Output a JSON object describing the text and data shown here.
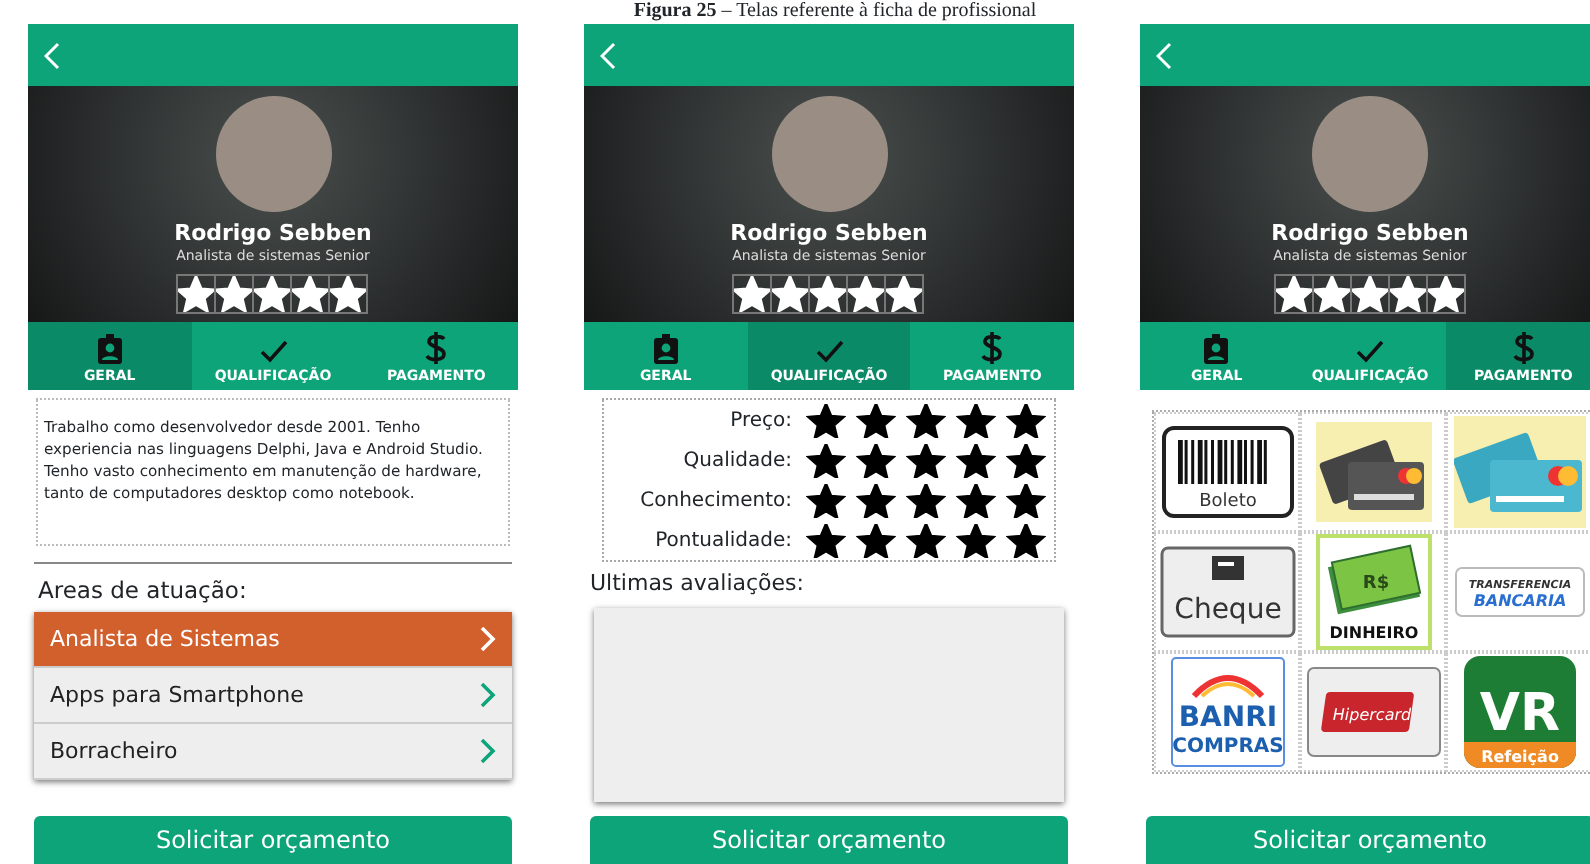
{
  "caption": "**Figura 25** – Telas referente à ficha de profissional",
  "screens": [
    {
      "profile": {
        "name": "Rodrigo Sebben",
        "role": "Analista de sistemas Senior",
        "stars": 5
      },
      "tabs": [
        {
          "label": "GERAL",
          "selected": true
        },
        {
          "label": "QUALIFICAÇÃO",
          "selected": false
        },
        {
          "label": "PAGAMENTO",
          "selected": false
        }
      ],
      "content": {
        "kind": "about",
        "text": "Trabalho como desenvolvedor desde 2001. Tenho experiencia nas linguagens Delphi, Java e Android Studio. Tenho vasto conhecimento em manutenção de hardware, tanto de computadores desktop como notebook.",
        "section_label": "Areas de atuação:",
        "areas": [
          {
            "label": "Analista de Sistemas",
            "selected": true
          },
          {
            "label": "Apps para Smartphone",
            "selected": false
          },
          {
            "label": "Borracheiro",
            "selected": false
          }
        ]
      },
      "button": "Solicitar orçamento"
    },
    {
      "profile": {
        "name": "Rodrigo Sebben",
        "role": "Analista de sistemas Senior",
        "stars": 5
      },
      "tabs": [
        {
          "label": "GERAL",
          "selected": false
        },
        {
          "label": "QUALIFICAÇÃO",
          "selected": true
        },
        {
          "label": "PAGAMENTO",
          "selected": false
        }
      ],
      "content": {
        "kind": "ratings",
        "criteria": [
          {
            "label": "Preço:",
            "stars": 5
          },
          {
            "label": "Qualidade:",
            "stars": 5
          },
          {
            "label": "Conhecimento:",
            "stars": 5
          },
          {
            "label": "Pontualidade:",
            "stars": 5
          }
        ],
        "section_label": "Ultimas avaliações:"
      },
      "button": "Solicitar orçamento"
    },
    {
      "profile": {
        "name": "Rodrigo Sebben",
        "role": "Analista de sistemas Senior",
        "stars": 5
      },
      "tabs": [
        {
          "label": "GERAL",
          "selected": false
        },
        {
          "label": "QUALIFICAÇÃO",
          "selected": false
        },
        {
          "label": "PAGAMENTO",
          "selected": true
        }
      ],
      "content": {
        "kind": "payments",
        "methods": [
          {
            "kind": "boleto",
            "label": "Boleto"
          },
          {
            "kind": "debit_card"
          },
          {
            "kind": "credit_card"
          },
          {
            "kind": "cheque",
            "label": "Cheque"
          },
          {
            "kind": "cash",
            "sign": "R$",
            "label": "DINHEIRO"
          },
          {
            "kind": "transfer",
            "lines": [
              "TRANSFERENCIA",
              "BANCARIA"
            ]
          },
          {
            "kind": "banricompras",
            "lines": [
              "BANRI",
              "COMPRAS"
            ]
          },
          {
            "kind": "hipercard",
            "label": "Hipercard"
          },
          {
            "kind": "vr",
            "label": "VR",
            "sub": "Refeição"
          }
        ]
      },
      "button": "Solicitar orçamento"
    }
  ]
}
